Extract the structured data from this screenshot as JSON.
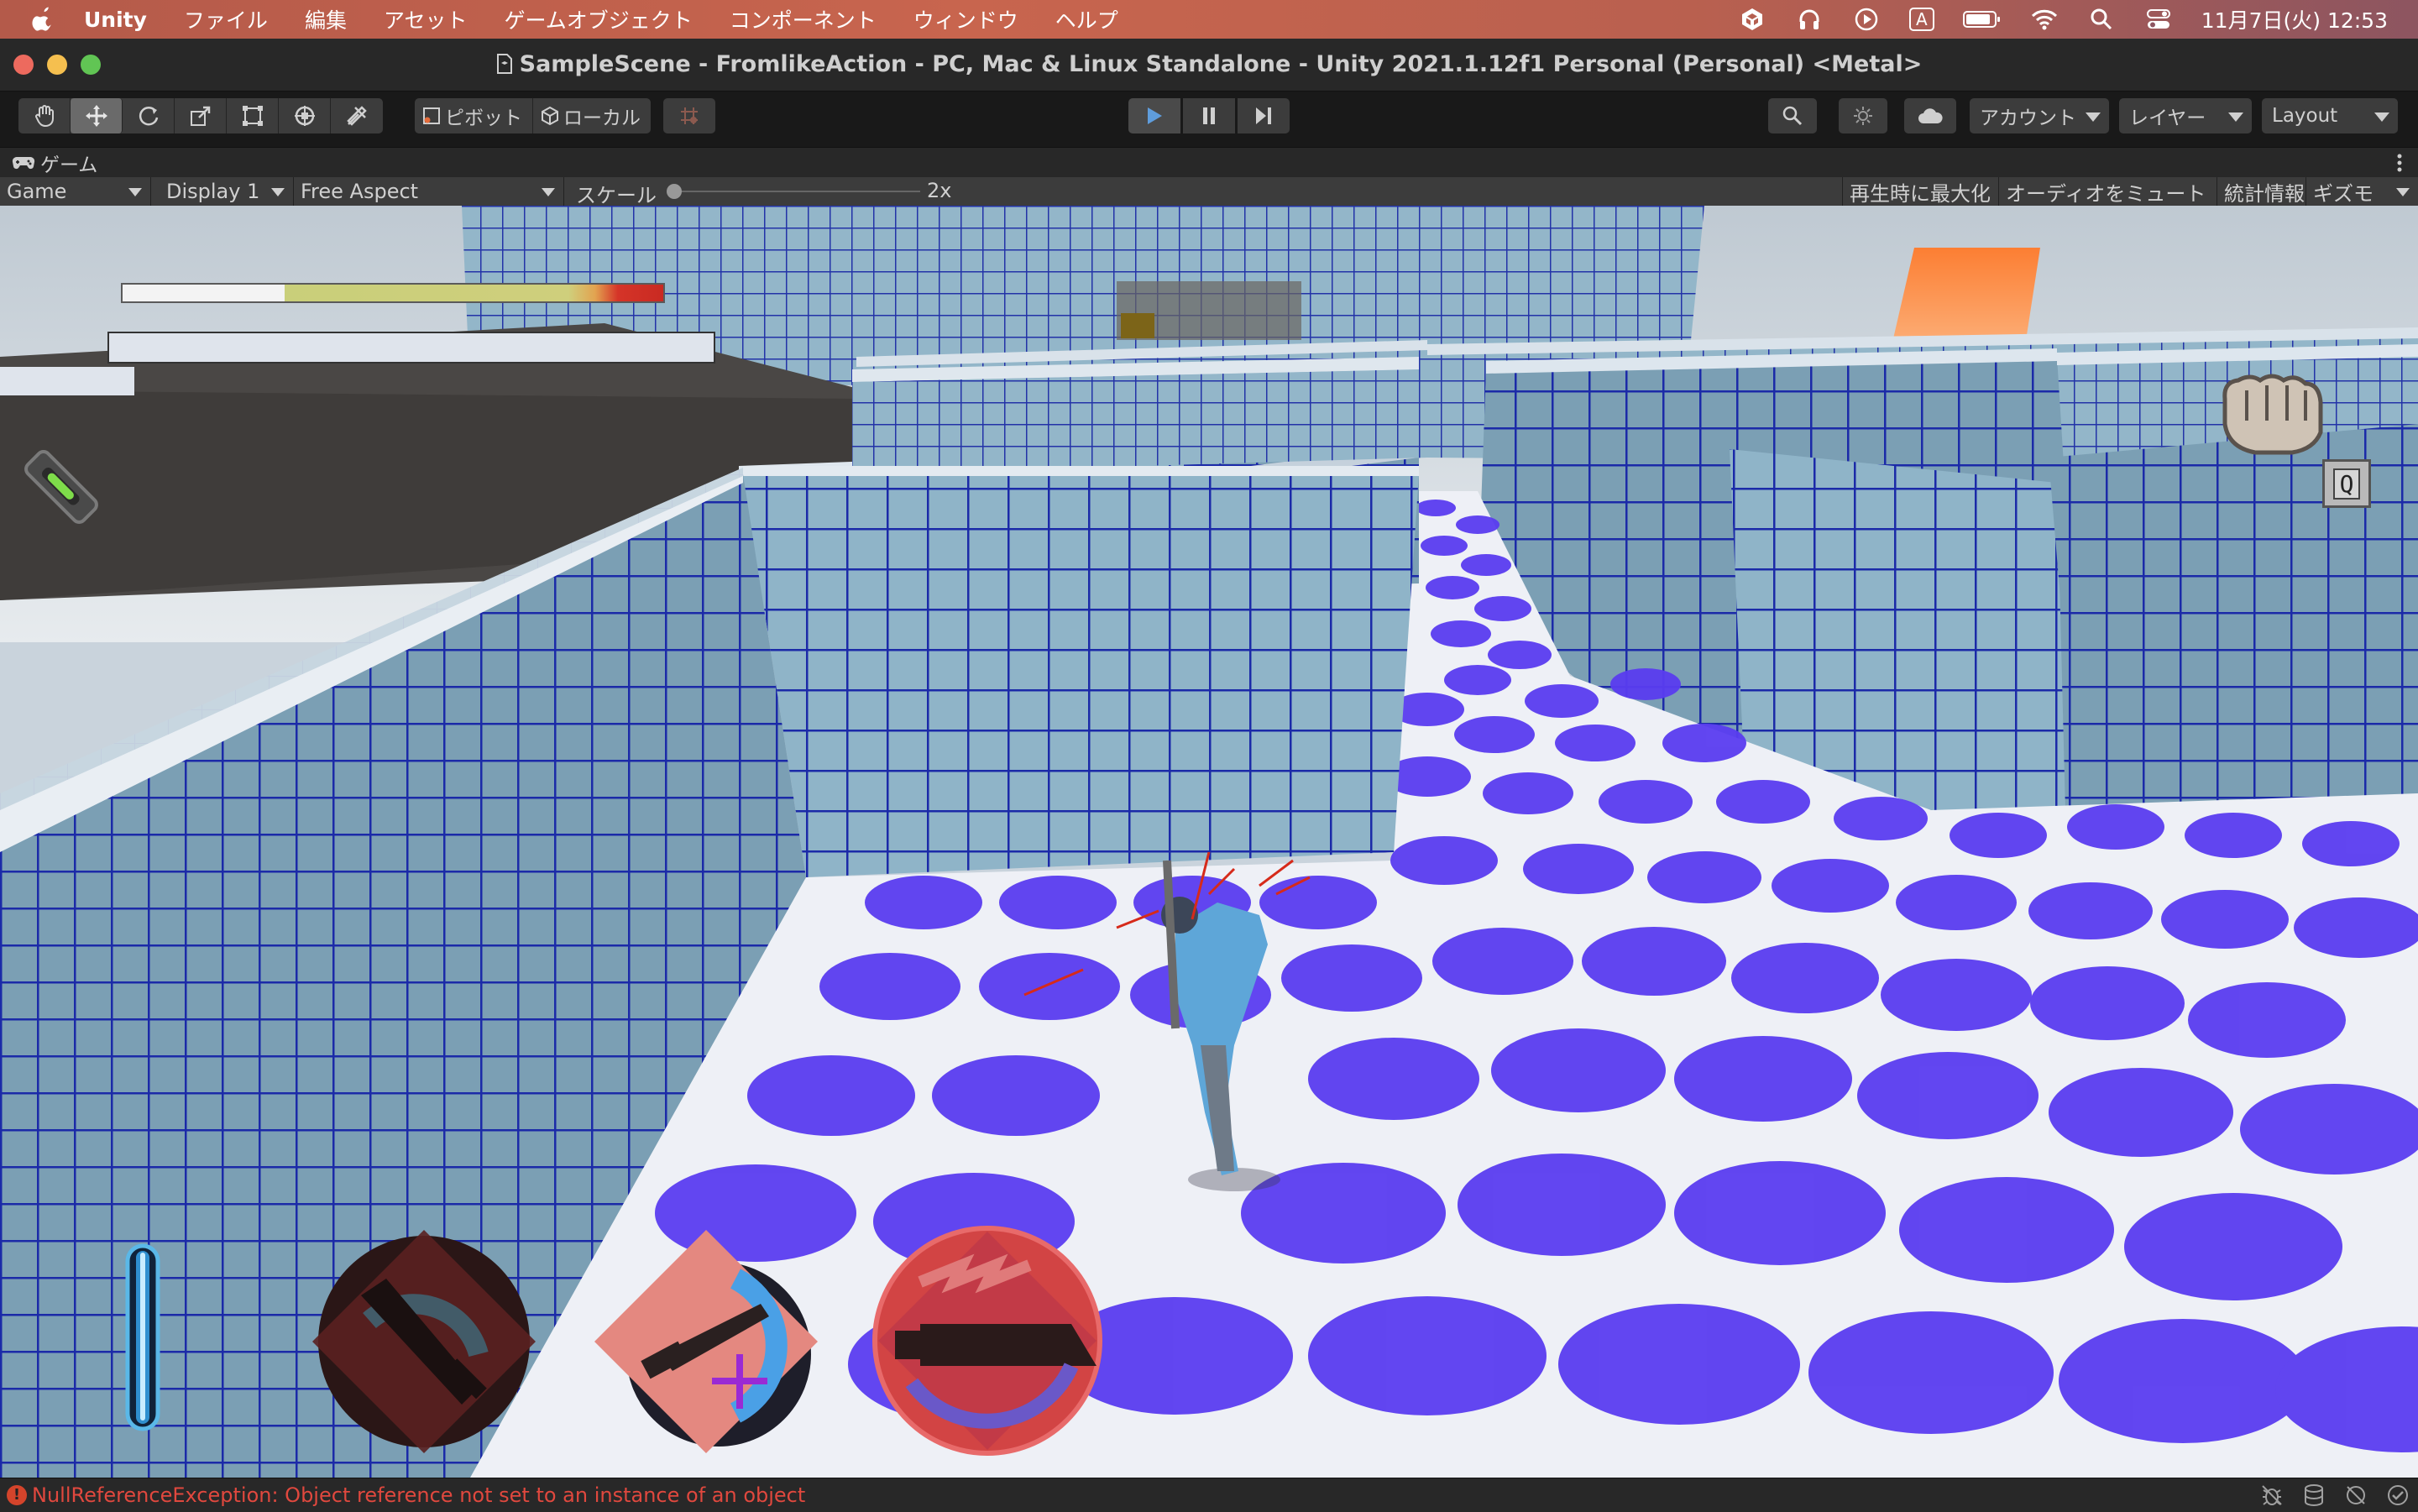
{
  "menubar": {
    "app_name": "Unity",
    "menus": [
      "ファイル",
      "編集",
      "アセット",
      "ゲームオブジェクト",
      "コンポーネント",
      "ウィンドウ",
      "ヘルプ"
    ],
    "clock": "11月7日(火) 12:53",
    "input_indicator": "A",
    "icons": [
      "unity-icon",
      "headphones-icon",
      "play-circle-icon",
      "input-source-icon",
      "battery-icon",
      "wifi-icon",
      "spotlight-search-icon",
      "control-center-icon"
    ]
  },
  "window": {
    "title": "SampleScene - FromlikeAction - PC, Mac & Linux Standalone - Unity 2021.1.12f1 Personal (Personal) <Metal>"
  },
  "toolbar": {
    "tools": [
      "hand-tool-icon",
      "move-tool-icon",
      "rotate-tool-icon",
      "scale-tool-icon",
      "rect-tool-icon",
      "transform-tool-icon",
      "custom-tool-icon"
    ],
    "active_tool": "move-tool-icon",
    "pivot_label": "ピボット",
    "local_label": "ローカル",
    "account_label": "アカウント",
    "layers_label": "レイヤー",
    "layout_label": "Layout"
  },
  "game_tab": {
    "label": "ゲーム"
  },
  "game_view_bar": {
    "mode": "Game",
    "display": "Display 1",
    "aspect": "Free Aspect",
    "scale_label": "スケール",
    "scale_value": "2x",
    "maximize_on_play": "再生時に最大化",
    "mute_audio": "オーディオをミュート",
    "stats": "統計情報",
    "gizmos": "ギズモ"
  },
  "hud": {
    "health_fraction": 0.7,
    "interact_key": "Q",
    "skill_icons": [
      "sword-swap-skill-icon",
      "sword-heal-skill-icon",
      "sword-dash-skill-icon"
    ],
    "stamina_fraction": 0.95
  },
  "status_bar": {
    "error_message": "NullReferenceException: Object reference not set to an instance of an object"
  },
  "colors": {
    "menubar_accent": "#c8654e",
    "error_text": "#e0483e",
    "floor_dot": "#5a3cf0",
    "wall_line": "#1b2aa8",
    "wall_face": "#8fb4c8"
  }
}
